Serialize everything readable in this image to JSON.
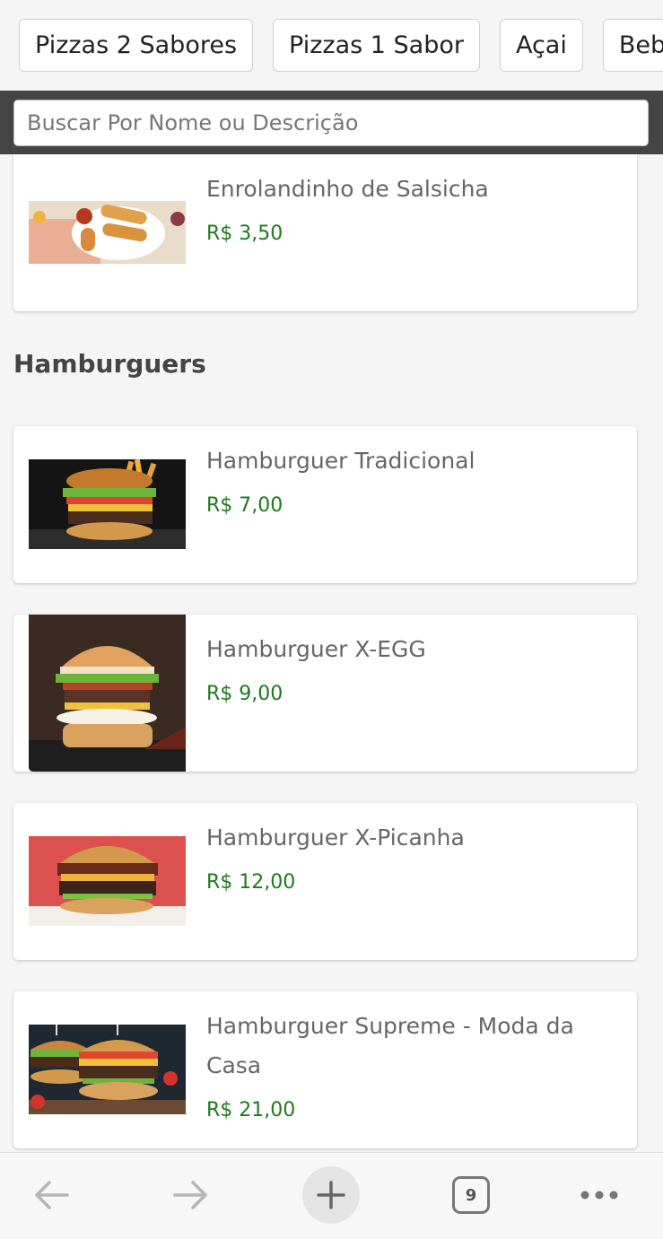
{
  "categories": [
    "Pizzas 2 Sabores",
    "Pizzas 1 Sabor",
    "Açai",
    "Beb"
  ],
  "search": {
    "placeholder": "Buscar Por Nome ou Descrição"
  },
  "previous_item": {
    "name": "Enrolandinho de Salsicha",
    "price": "R$ 3,50"
  },
  "section": {
    "title": "Hamburguers"
  },
  "products": [
    {
      "name": "Hamburguer Tradicional",
      "price": "R$ 7,00"
    },
    {
      "name": "Hamburguer X-EGG",
      "price": "R$ 9,00"
    },
    {
      "name": "Hamburguer X-Picanha",
      "price": "R$ 12,00"
    },
    {
      "name": "Hamburguer Supreme - Moda da Casa",
      "price": "R$ 21,00"
    }
  ],
  "bottom_nav": {
    "tab_count": "9"
  },
  "colors": {
    "price": "#1f7a1f",
    "header_bg": "#444444"
  },
  "icons": [
    "back-arrow-icon",
    "forward-arrow-icon",
    "plus-icon",
    "tabs-icon",
    "more-icon"
  ]
}
